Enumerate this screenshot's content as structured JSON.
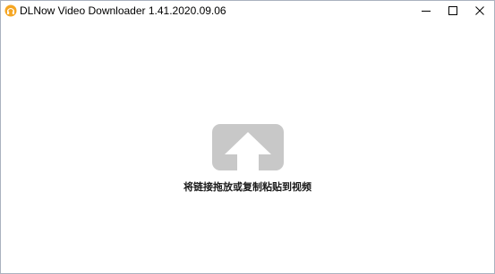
{
  "window": {
    "title": "DLNow Video Downloader 1.41.2020.09.06",
    "app_icon": "dlnow-app-icon",
    "controls": {
      "minimize_icon": "minimize-icon",
      "maximize_icon": "maximize-icon",
      "close_icon": "close-icon"
    }
  },
  "main": {
    "drop_zone_icon": "upload-arrow-icon",
    "drop_zone_icon_color": "#c8c8c8",
    "instruction_text": "将链接拖放或复制粘贴到视频"
  }
}
